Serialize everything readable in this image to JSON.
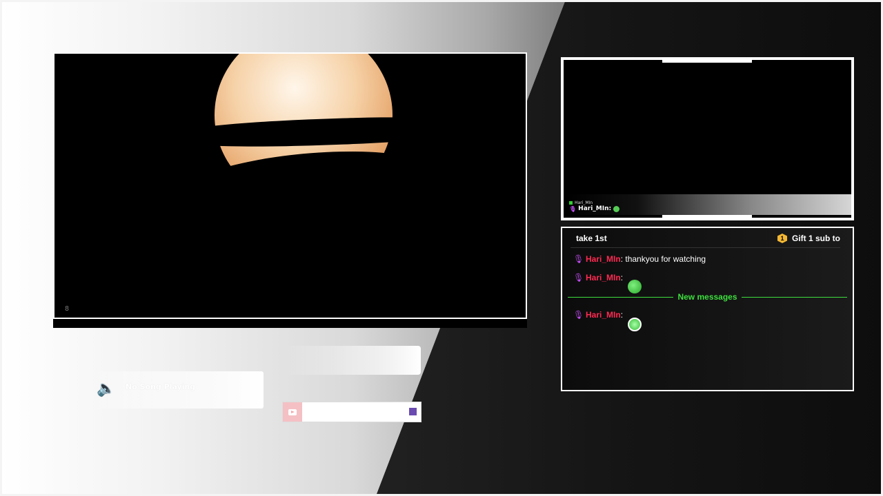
{
  "overlay": {
    "main_video": {
      "controls_icon": "8"
    },
    "camera": {
      "mini_chat": {
        "badge_name": "Hari_MIn",
        "line_user": "Hari_MIn:"
      }
    },
    "chat": {
      "header_left": "take 1st",
      "gift_badge_number": "1",
      "header_right": "Gift 1 sub to",
      "messages": [
        {
          "user": "Hari_MIn",
          "text": ": thankyou for watching"
        },
        {
          "user": "Hari_MIn",
          "text": ":"
        },
        {
          "user": "Hari_MIn",
          "text": ":"
        }
      ],
      "divider_label": "New messages",
      "colors": {
        "username": "#ff2a52",
        "divider": "#3ddf3d",
        "mic": "#c04cf0"
      }
    },
    "now_playing": {
      "title": "No Song Playing",
      "subtitle": "-"
    },
    "icons": {
      "speaker": "speaker-icon",
      "youtube": "youtube-icon",
      "gift": "gift-badge-icon",
      "mic": "microphone-icon"
    }
  }
}
